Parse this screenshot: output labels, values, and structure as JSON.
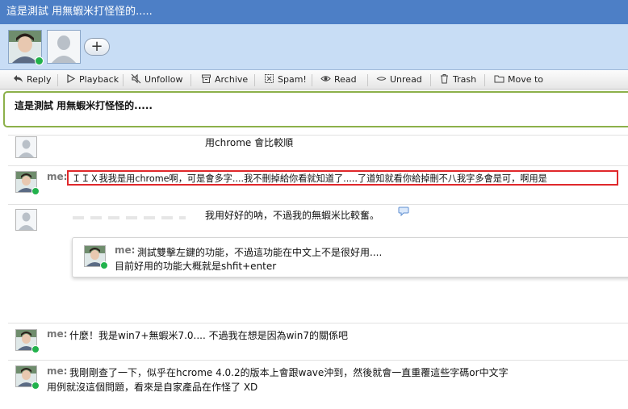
{
  "window": {
    "title": "這是測試 用無蝦米打怪怪的....."
  },
  "participants": {
    "add_label": "+"
  },
  "toolbar": {
    "reply": "Reply",
    "playback": "Playback",
    "unfollow": "Unfollow",
    "archive": "Archive",
    "spam": "Spam!",
    "read": "Read",
    "unread": "Unread",
    "trash": "Trash",
    "move_to": "Move to"
  },
  "subject": "這是測試 用無蝦米打怪怪的.....",
  "messages": [
    {
      "author": "",
      "text": "用chrome 會比較順"
    },
    {
      "author": "me:",
      "text": "ＩＩＸ我我是用chrome啊，可是會多字....我不刪掉給你看就知道了.....了道知就看你給掉刪不八我字多會是可，啊用是"
    },
    {
      "author": "",
      "text": "我用好好的呐，不過我的無蝦米比較奮。"
    },
    {
      "author": "me:",
      "text": "測試雙擊左鍵的功能，不過這功能在中文上不是很好用....",
      "text2": "目前好用的功能大概就是shfit+enter"
    },
    {
      "author": "me:",
      "text": "什麼！我是win7+無蝦米7.0.... 不過我在想是因為win7的關係吧"
    },
    {
      "author": "me:",
      "text": "我剛剛查了一下，似乎在hcrome 4.0.2的版本上會跟wave沖到，然後就會一直重覆這些字碼or中文字",
      "text2": "用例就沒這個問題，看來是自家產品在作怪了   XD"
    }
  ],
  "colors": {
    "title_bar": "#4d7fc6",
    "participants_bg": "#c8ddf5",
    "subject_border": "#8cb04a",
    "online": "#22b24c",
    "highlight": "#e0282b"
  }
}
